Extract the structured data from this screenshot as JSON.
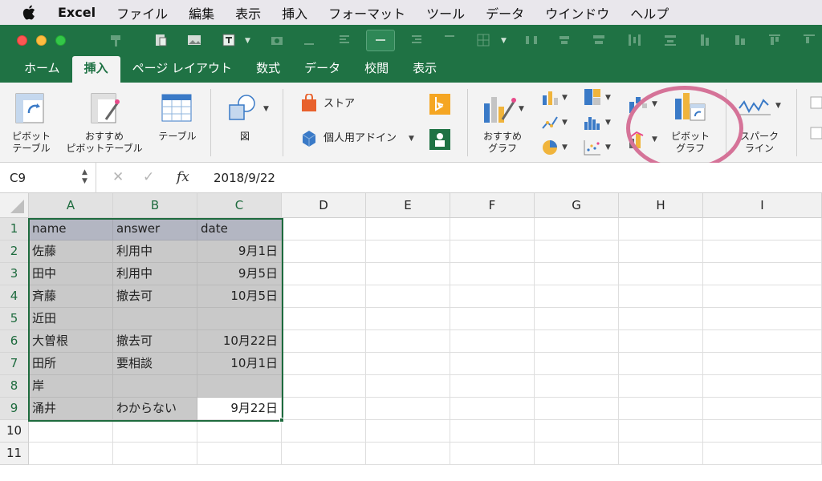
{
  "menubar": {
    "app_name": "Excel",
    "items": [
      "ファイル",
      "編集",
      "表示",
      "挿入",
      "フォーマット",
      "ツール",
      "データ",
      "ウインドウ",
      "ヘルプ"
    ]
  },
  "tabs": [
    "ホーム",
    "挿入",
    "ページ レイアウト",
    "数式",
    "データ",
    "校閲",
    "表示"
  ],
  "active_tab": "挿入",
  "ribbon": {
    "pivot_table": "ピボット\nテーブル",
    "recommended_pivot": "おすすめ\nピボットテーブル",
    "table": "テーブル",
    "shapes": "図",
    "store": "ストア",
    "addins": "個人用アドイン",
    "recommended_charts": "おすすめ\nグラフ",
    "pivot_chart": "ピボット\nグラフ",
    "sparkline": "スパーク\nライン"
  },
  "formula_bar": {
    "name_box": "C9",
    "value": "2018/9/22"
  },
  "grid": {
    "columns": [
      "A",
      "B",
      "C",
      "D",
      "E",
      "F",
      "G",
      "H",
      "I"
    ],
    "rows": [
      "1",
      "2",
      "3",
      "4",
      "5",
      "6",
      "7",
      "8",
      "9",
      "10",
      "11"
    ],
    "data": [
      [
        "name",
        "answer",
        "date"
      ],
      [
        "佐藤",
        "利用中",
        "9月1日"
      ],
      [
        "田中",
        "利用中",
        "9月5日"
      ],
      [
        "斉藤",
        "撤去可",
        "10月5日"
      ],
      [
        "近田",
        "",
        ""
      ],
      [
        "大曽根",
        "撤去可",
        "10月22日"
      ],
      [
        "田所",
        "要相談",
        "10月1日"
      ],
      [
        "岸",
        "",
        ""
      ],
      [
        "涌井",
        "わからない",
        "9月22日"
      ]
    ]
  },
  "colors": {
    "excel_green": "#1f7244",
    "highlight_ring": "#d57398",
    "selection_border": "#1e6b3e"
  }
}
